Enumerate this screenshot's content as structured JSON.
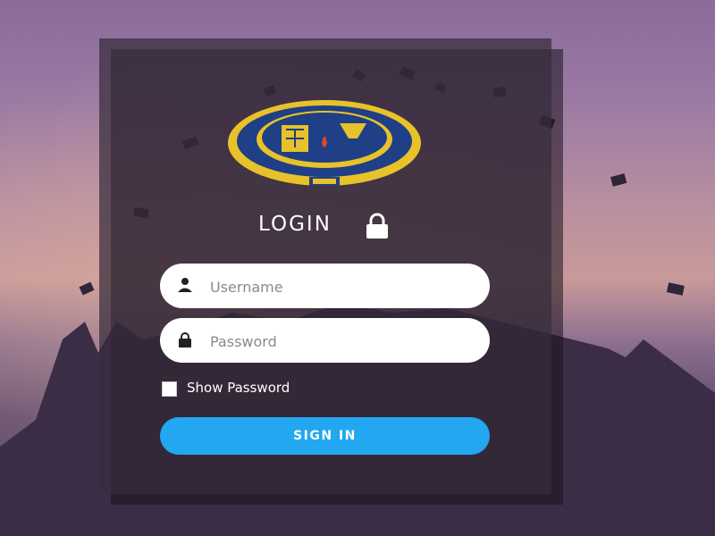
{
  "login": {
    "title": "LOGIN",
    "title_icon": "lock-icon",
    "seal_icon": "university-seal-logo"
  },
  "form": {
    "username": {
      "placeholder": "Username",
      "value": "",
      "icon": "user-icon"
    },
    "password": {
      "placeholder": "Password",
      "value": "",
      "icon": "lock-icon"
    },
    "show_password": {
      "label": "Show Password",
      "checked": false
    },
    "submit_label": "SIGN IN"
  },
  "colors": {
    "primary_button": "#22a7f0",
    "panel_overlay": "#372d3c",
    "seal_gold": "#e8c22a",
    "seal_blue": "#1f3f86"
  }
}
